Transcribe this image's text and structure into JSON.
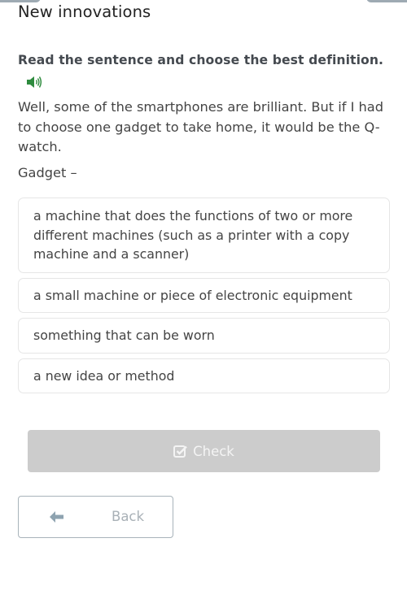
{
  "header": {
    "title": "New innovations"
  },
  "exercise": {
    "instruction": "Read the sentence and choose the best definition.",
    "audio_icon": "speaker-icon",
    "sentence": "Well, some of the smartphones are brilliant. But if I had to choose one gadget to take home, it would be the Q-watch.",
    "prompt": "Gadget –",
    "options": [
      {
        "label": "a machine that does the functions of two or more different machines (such as a printer with a copy machine and a scanner)"
      },
      {
        "label": "a small machine or piece of electronic equipment"
      },
      {
        "label": "something that can be worn"
      },
      {
        "label": "a new idea or method"
      }
    ]
  },
  "actions": {
    "check_label": "Check",
    "check_icon": "checkbox-icon",
    "back_label": "Back",
    "back_icon": "arrow-left-icon"
  },
  "colors": {
    "accent_audio": "#2e8b3e",
    "check_disabled_bg": "#cccccc",
    "back_border": "#a8b3ba"
  }
}
